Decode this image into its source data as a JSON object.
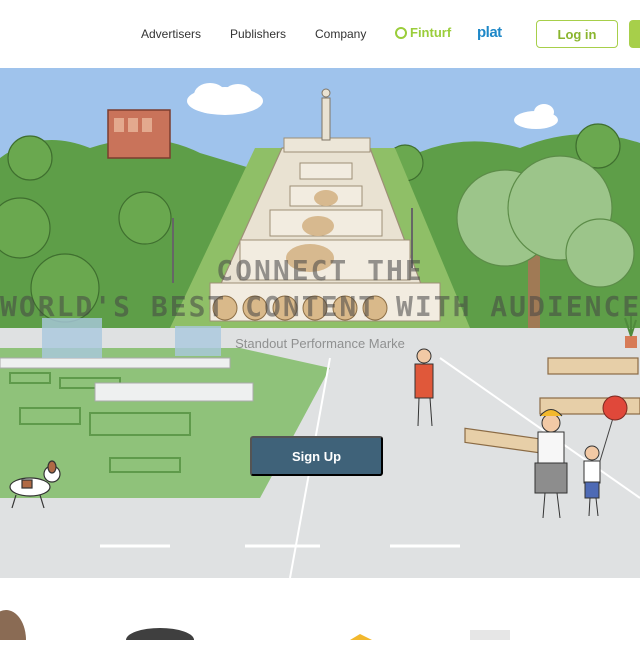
{
  "nav": {
    "links": [
      "Advertisers",
      "Publishers",
      "Company"
    ],
    "brand_finturf": "Finturf",
    "brand_plat": "plat",
    "login_label": "Log in"
  },
  "hero": {
    "title_line1": "CONNECT THE",
    "title_line2": "WORLD'S BEST CONTENT WITH AUDIENCE",
    "subtitle": "Standout Performance Marke",
    "cta_label": "Sign Up"
  },
  "colors": {
    "accent_green": "#a7cf4a",
    "cta_blue": "#3f6279",
    "sky": "#9fc3ec",
    "plat_blue": "#1e88c8"
  }
}
